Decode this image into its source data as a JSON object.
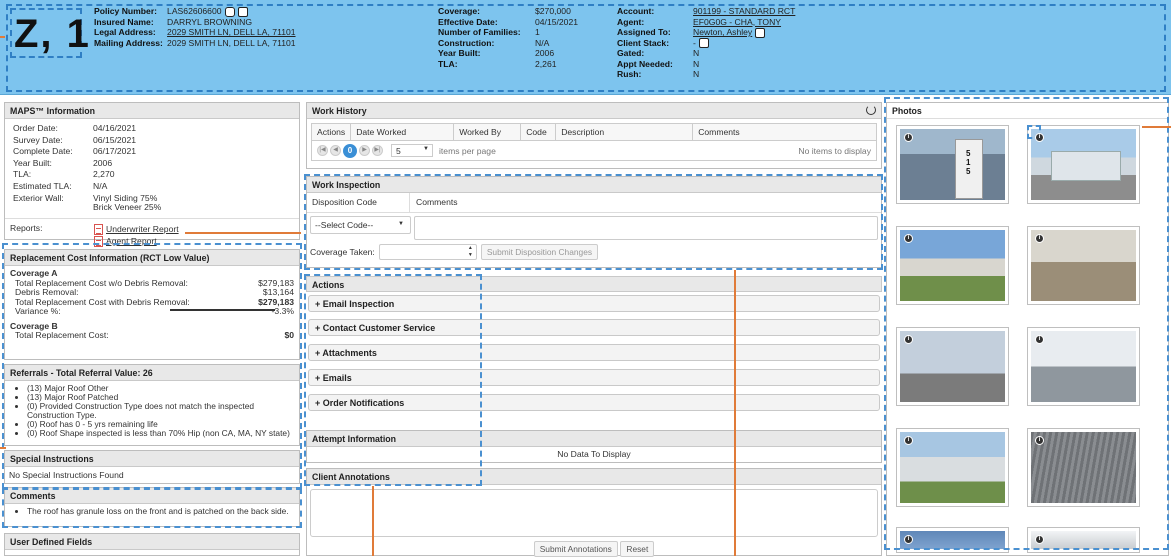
{
  "header": {
    "big_id": "Z, 1",
    "policy_number_label": "Policy Number:",
    "policy_number": "LAS62606600",
    "insured_name_label": "Insured Name:",
    "insured_name": "DARRYL BROWNING",
    "legal_address_label": "Legal Address:",
    "legal_address": "2029 SMITH LN, DELL LA, 71101",
    "mailing_address_label": "Mailing Address:",
    "mailing_address": "2029 SMITH LN, DELL LA, 71101",
    "coverage_label": "Coverage:",
    "coverage": "$270,000",
    "effective_date_label": "Effective Date:",
    "effective_date": "04/15/2021",
    "families_label": "Number of Families:",
    "families": "1",
    "construction_label": "Construction:",
    "construction": "N/A",
    "year_built_label": "Year Built:",
    "year_built": "2006",
    "tla_label": "TLA:",
    "tla": "2,261",
    "account_label": "Account:",
    "account": "901199 - STANDARD RCT",
    "agent_label": "Agent:",
    "agent": "EF0G0G - CHA, TONY",
    "assigned_to_label": "Assigned To:",
    "assigned_to": "Newton, Ashley",
    "client_stack_label": "Client Stack:",
    "client_stack": "-",
    "gated_label": "Gated:",
    "gated": "N",
    "appt_needed_label": "Appt Needed:",
    "appt_needed": "N",
    "rush_label": "Rush:",
    "rush": "N"
  },
  "maps": {
    "title": "MAPS™ Information",
    "rows": [
      {
        "k": "Order Date:",
        "v": "04/16/2021"
      },
      {
        "k": "Survey Date:",
        "v": "06/15/2021"
      },
      {
        "k": "Complete Date:",
        "v": "06/17/2021"
      },
      {
        "k": "Year Built:",
        "v": "2006"
      },
      {
        "k": "TLA:",
        "v": "2,270"
      },
      {
        "k": "Estimated TLA:",
        "v": "N/A"
      }
    ],
    "exterior_wall_label": "Exterior Wall:",
    "exterior_wall_1": "Vinyl Siding 75%",
    "exterior_wall_2": "Brick Veneer 25%",
    "reports_label": "Reports:",
    "report_1": "Underwriter Report",
    "report_2": "Agent Report"
  },
  "rct": {
    "title": "Replacement Cost Information (RCT Low Value)",
    "coverage_a": "Coverage A",
    "rows": [
      {
        "k": "Total Replacement Cost w/o Debris Removal:",
        "v": "$279,183"
      },
      {
        "k": "Debris Removal:",
        "v": "$13,164"
      },
      {
        "k": "Total Replacement Cost with Debris Removal:",
        "v": "$279,183"
      },
      {
        "k": "Variance %:",
        "v": "-3.3%"
      }
    ],
    "coverage_b": "Coverage B",
    "cov_b_label": "Total Replacement Cost:",
    "cov_b_value": "$0"
  },
  "referrals": {
    "title": "Referrals - Total Referral Value: 26",
    "items": [
      "(13) Major Roof Other",
      "(13) Major Roof Patched",
      "(0) Provided Construction Type does not match the inspected Construction Type.",
      "(0) Roof has 0 - 5 yrs remaining life",
      "(0) Roof Shape inspected is less than 70% Hip (non CA, MA, NY state)"
    ]
  },
  "special": {
    "title": "Special Instructions",
    "text": "No Special Instructions Found"
  },
  "comments": {
    "title": "Comments",
    "items": [
      "The roof has granule loss on the front and is patched on the back side."
    ]
  },
  "user_defined": {
    "title": "User Defined Fields"
  },
  "work_history": {
    "title": "Work History",
    "columns": [
      "Actions",
      "Date Worked",
      "Worked By",
      "Code",
      "Description",
      "Comments"
    ],
    "page": "0",
    "page_size": "5",
    "items_per_page": "items per page",
    "empty": "No items to display"
  },
  "work_inspection": {
    "title": "Work Inspection",
    "col_disposition": "Disposition Code",
    "col_comments": "Comments",
    "select_placeholder": "--Select Code--",
    "coverage_taken_label": "Coverage Taken:",
    "submit_label": "Submit Disposition Changes"
  },
  "actions": {
    "title": "Actions",
    "items": [
      "+ Email Inspection",
      "+ Contact Customer Service",
      "+ Attachments",
      "+ Emails",
      "+ Order Notifications"
    ]
  },
  "attempt": {
    "title": "Attempt Information",
    "empty": "No Data To Display"
  },
  "annotations": {
    "title": "Client Annotations",
    "submit_label": "Submit Annotations",
    "reset_label": "Reset"
  },
  "photos": {
    "title": "Photos"
  },
  "colors": {
    "header_bg": "#7dc4ee",
    "dashed": "#4a90d0",
    "orange": "#e07b39",
    "pdf": "#d9534f"
  }
}
